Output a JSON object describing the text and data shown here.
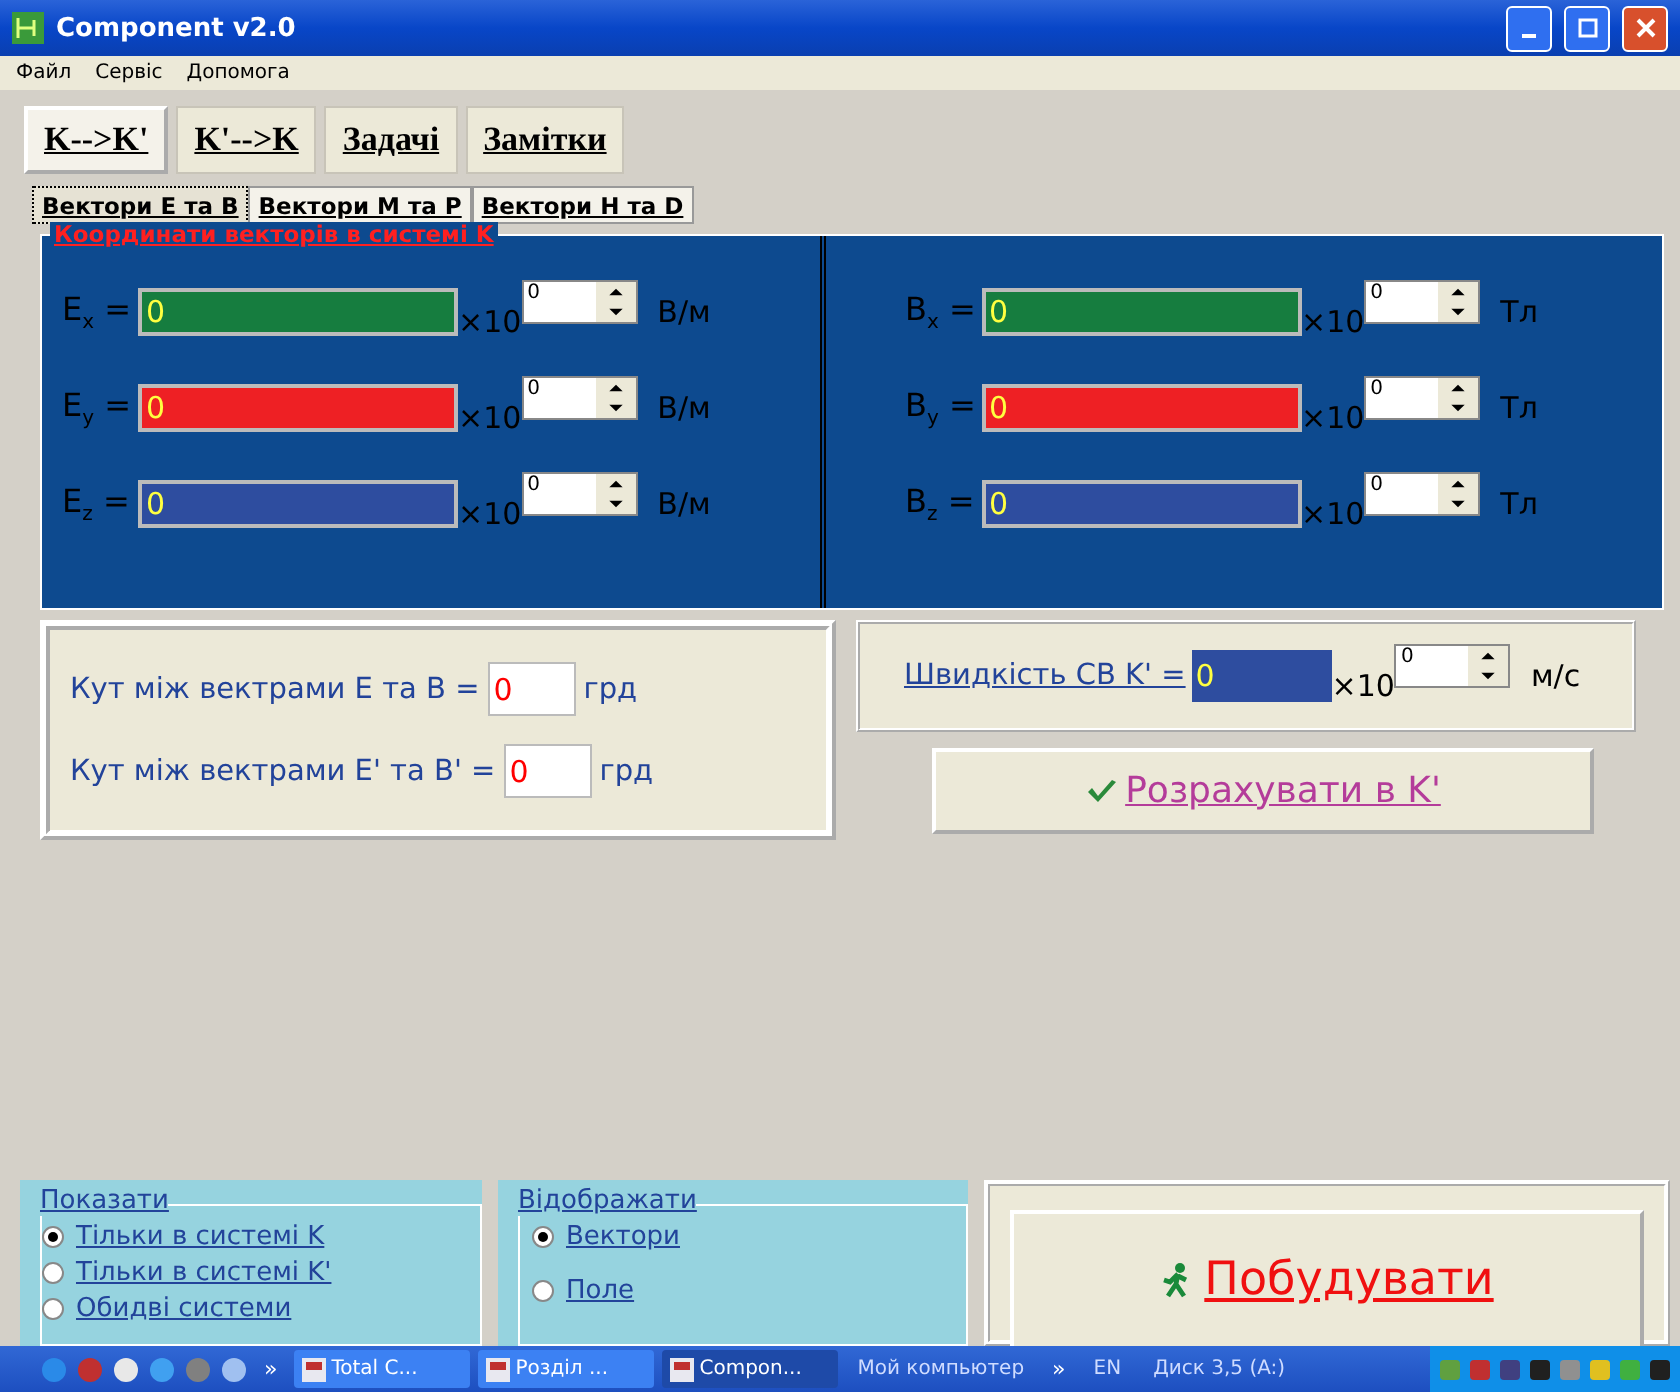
{
  "window": {
    "title": "Component v2.0"
  },
  "menu": [
    "Файл",
    "Сервіс",
    "Допомога"
  ],
  "main_tabs": [
    {
      "label": "K-->K'",
      "selected": true
    },
    {
      "label": "K'-->K",
      "selected": false
    },
    {
      "label": "Задачі",
      "selected": false
    },
    {
      "label": "Замітки",
      "selected": false
    }
  ],
  "sub_tabs": [
    {
      "label": "Вектори E та B",
      "selected": true
    },
    {
      "label": "Вектори M та P",
      "selected": false
    },
    {
      "label": "Вектори H та D",
      "selected": false
    }
  ],
  "coords_group": {
    "title": "Координати векторів в системі K",
    "columns": [
      [
        {
          "label": "E$_{x}$ =",
          "value": "0",
          "color": "#167d3f",
          "multiplier": "×10",
          "exponent": "0",
          "unit": "В/м"
        },
        {
          "label": "E$_{y}$ =",
          "value": "0",
          "color": "#ee2024",
          "multiplier": "×10",
          "exponent": "0",
          "unit": "В/м"
        },
        {
          "label": "E$_{z}$ =",
          "value": "0",
          "color": "#2e4d9f",
          "multiplier": "×10",
          "exponent": "0",
          "unit": "В/м"
        }
      ],
      [
        {
          "label": "B$_{x}$ =",
          "value": "0",
          "color": "#167d3f",
          "multiplier": "×10",
          "exponent": "0",
          "unit": "Тл"
        },
        {
          "label": "B$_{y}$ =",
          "value": "0",
          "color": "#ee2024",
          "multiplier": "×10",
          "exponent": "0",
          "unit": "Тл"
        },
        {
          "label": "B$_{z}$ =",
          "value": "0",
          "color": "#2e4d9f",
          "multiplier": "×10",
          "exponent": "0",
          "unit": "Тл"
        }
      ]
    ]
  },
  "angles": [
    {
      "label": "Кут між вектрами E та B =",
      "value": "0",
      "unit": "грд"
    },
    {
      "label": "Кут між вектрами E' та B' =",
      "value": "0",
      "unit": "грд"
    }
  ],
  "speed": {
    "label": "Швидкість СВ K' =",
    "value": "0",
    "multiplier": "×10",
    "exponent": "0",
    "unit": "м/с"
  },
  "calculate_button": "Розрахувати в K'",
  "show_group": {
    "title": "Показати",
    "options": [
      {
        "label": "Тільки в системі K",
        "selected": true
      },
      {
        "label": "Тільки в системі K'",
        "selected": false
      },
      {
        "label": "Обидві системи",
        "selected": false
      }
    ]
  },
  "display_group": {
    "title": "Відображати",
    "options": [
      {
        "label": "Вектори",
        "selected": true
      },
      {
        "label": "Поле",
        "selected": false
      }
    ]
  },
  "build_button": "Побудувати",
  "taskbar": {
    "chevrons": [
      "»",
      "»"
    ],
    "tasks": [
      {
        "label": "Total C...",
        "selected": false
      },
      {
        "label": "Розділ ...",
        "selected": false
      },
      {
        "label": "Compon...",
        "selected": true
      }
    ],
    "tray_texts": [
      "Мой компьютер",
      "EN",
      "Диск 3,5 (A:)"
    ]
  }
}
